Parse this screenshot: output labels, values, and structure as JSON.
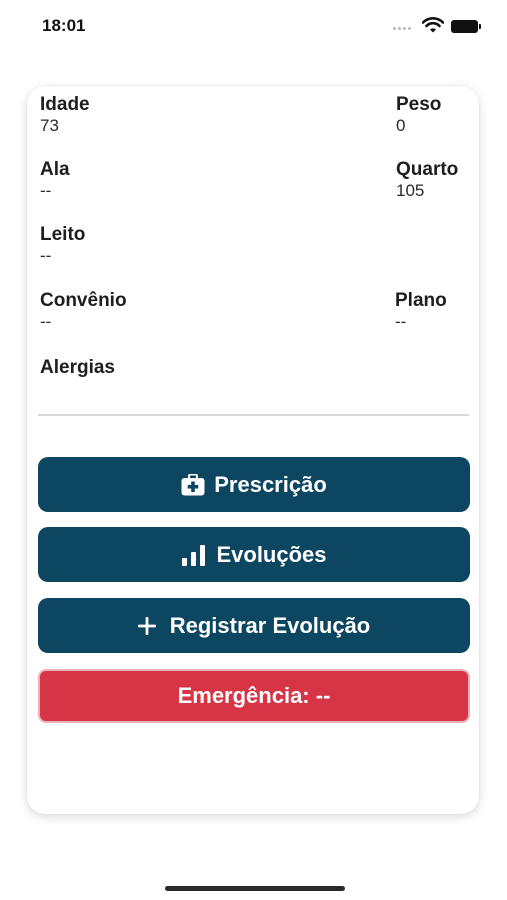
{
  "status_bar": {
    "time": "18:01"
  },
  "patient_info": {
    "idade": {
      "label": "Idade",
      "value": "73"
    },
    "peso": {
      "label": "Peso",
      "value": "0"
    },
    "ala": {
      "label": "Ala",
      "value": "--"
    },
    "quarto": {
      "label": "Quarto",
      "value": "105"
    },
    "leito": {
      "label": "Leito",
      "value": "--"
    },
    "convenio": {
      "label": "Convênio",
      "value": "--"
    },
    "plano": {
      "label": "Plano",
      "value": "--"
    },
    "alergias": {
      "label": "Alergias",
      "value": ""
    }
  },
  "actions": {
    "prescricao": {
      "label": "Prescrição",
      "icon": "medkit-icon"
    },
    "evolucoes": {
      "label": "Evoluções",
      "icon": "bar-chart-icon"
    },
    "registrar": {
      "label": "Registrar Evolução",
      "icon": "plus-icon"
    },
    "emergencia": {
      "label": "Emergência: --"
    }
  },
  "colors": {
    "primary_button": "#0c4660",
    "emergency_button": "#d73545"
  }
}
